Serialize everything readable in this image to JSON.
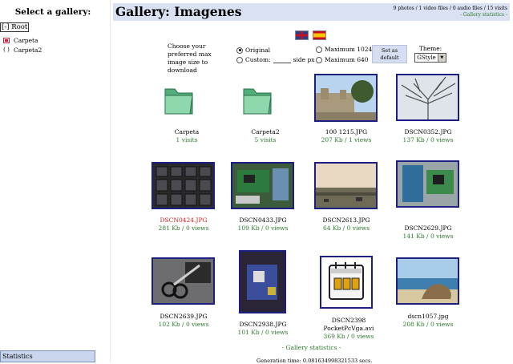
{
  "sidebar": {
    "title": "Select a gallery:",
    "root_label": "[-] Root",
    "folders": [
      {
        "label": "Carpeta",
        "mark": "[+]"
      },
      {
        "label": "Carpeta2",
        "mark": "( )"
      }
    ],
    "statistics_label": "Statistics"
  },
  "header": {
    "title": "Gallery: Imagenes",
    "counts": "9 photos / 1 video files / 0 audio files / 15 visits",
    "stats_link": "- Gallery statistics -"
  },
  "languages": [
    "english-flag",
    "spanish-flag"
  ],
  "prefs": {
    "text": "Choose your preferred max image size to download",
    "options": {
      "original": "Original",
      "custom": "Custom:",
      "side_px": "side px",
      "max1024": "Maximum 1024",
      "max640": "Maximum 640"
    },
    "selected": "original",
    "set_default": "Set as default",
    "theme_label": "Theme:",
    "theme_value": "GStyle"
  },
  "items": [
    {
      "name": "Carpeta",
      "info": "1 visits",
      "type": "folder"
    },
    {
      "name": "Carpeta2",
      "info": "5 visits",
      "type": "folder"
    },
    {
      "name": "100 1215.JPG",
      "info": "207 Kb / 1 views",
      "type": "castle"
    },
    {
      "name": "DSCN0352.JPG",
      "info": "137 Kb / 0 views",
      "type": "tree"
    },
    {
      "name": "DSCN0424.JPG",
      "info": "281 Kb / 0 views",
      "type": "keyboard",
      "highlight": true
    },
    {
      "name": "DSCN0433.JPG",
      "info": "109 Kb / 0 views",
      "type": "circuit"
    },
    {
      "name": "DSCN2613.JPG",
      "info": "64 Kb / 0 views",
      "type": "landscape"
    },
    {
      "name": "DSCN2629.JPG",
      "info": "141 Kb / 0 views",
      "type": "board"
    },
    {
      "name": "DSCN2639.JPG",
      "info": "102 Kb / 0 views",
      "type": "scissors"
    },
    {
      "name": "DSCN2938.JPG",
      "info": "101 Kb / 0 views",
      "type": "motherboard"
    },
    {
      "name": "DSCN2398 PocketPcVga.avi",
      "info": "369 Kb / 0 views",
      "type": "video"
    },
    {
      "name": "dscn1057.jpg",
      "info": "208 Kb / 0 views",
      "type": "beach"
    }
  ],
  "footer": {
    "stats_link": "- Gallery statistics -",
    "generation": "Generation time: 0.081634998321533 secs."
  }
}
